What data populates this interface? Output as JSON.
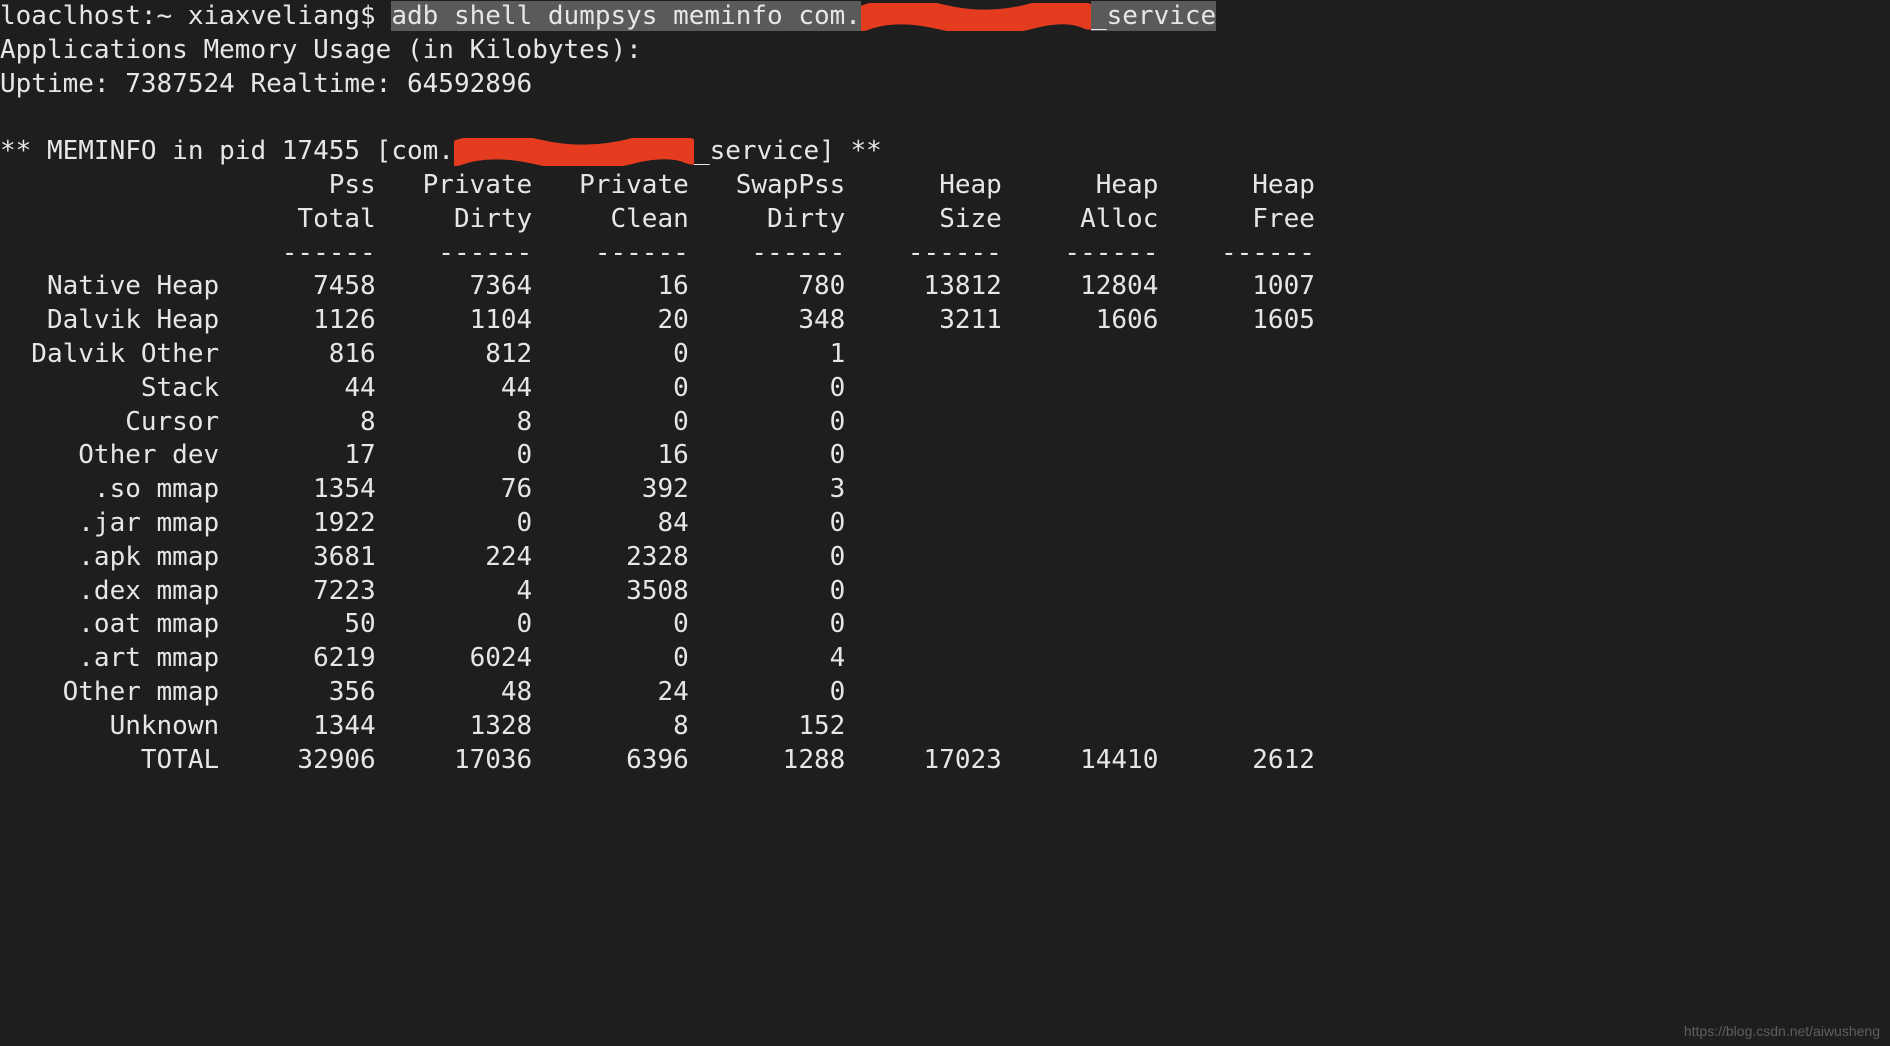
{
  "prompt": {
    "host_user": "loaclhost:~ xiaxveliang$ ",
    "cmd_prefix": "adb shell dumpsys meminfo com.",
    "cmd_suffix": "_service"
  },
  "header": {
    "line1": "Applications Memory Usage (in Kilobytes):",
    "line2_pref": "Uptime: ",
    "uptime": "7387524",
    "realtime_pref": " Realtime: ",
    "realtime": "64592896"
  },
  "meminfo_hdr": {
    "prefix": "** MEMINFO in pid ",
    "pid": "17455",
    "mid": " [com.",
    "suffix": "_service] **"
  },
  "cols": {
    "h1": [
      "",
      "Pss",
      "Private",
      "Private",
      "SwapPss",
      "Heap",
      "Heap",
      "Heap"
    ],
    "h2": [
      "",
      "Total",
      "Dirty",
      "Clean",
      "Dirty",
      "Size",
      "Alloc",
      "Free"
    ]
  },
  "rows": [
    {
      "name": "Native Heap",
      "v": [
        "7458",
        "7364",
        "16",
        "780",
        "13812",
        "12804",
        "1007"
      ]
    },
    {
      "name": "Dalvik Heap",
      "v": [
        "1126",
        "1104",
        "20",
        "348",
        "3211",
        "1606",
        "1605"
      ]
    },
    {
      "name": "Dalvik Other",
      "v": [
        "816",
        "812",
        "0",
        "1",
        "",
        "",
        ""
      ]
    },
    {
      "name": "Stack",
      "v": [
        "44",
        "44",
        "0",
        "0",
        "",
        "",
        ""
      ]
    },
    {
      "name": "Cursor",
      "v": [
        "8",
        "8",
        "0",
        "0",
        "",
        "",
        ""
      ]
    },
    {
      "name": "Other dev",
      "v": [
        "17",
        "0",
        "16",
        "0",
        "",
        "",
        ""
      ]
    },
    {
      "name": ".so mmap",
      "v": [
        "1354",
        "76",
        "392",
        "3",
        "",
        "",
        ""
      ]
    },
    {
      "name": ".jar mmap",
      "v": [
        "1922",
        "0",
        "84",
        "0",
        "",
        "",
        ""
      ]
    },
    {
      "name": ".apk mmap",
      "v": [
        "3681",
        "224",
        "2328",
        "0",
        "",
        "",
        ""
      ]
    },
    {
      "name": ".dex mmap",
      "v": [
        "7223",
        "4",
        "3508",
        "0",
        "",
        "",
        ""
      ]
    },
    {
      "name": ".oat mmap",
      "v": [
        "50",
        "0",
        "0",
        "0",
        "",
        "",
        ""
      ]
    },
    {
      "name": ".art mmap",
      "v": [
        "6219",
        "6024",
        "0",
        "4",
        "",
        "",
        ""
      ]
    },
    {
      "name": "Other mmap",
      "v": [
        "356",
        "48",
        "24",
        "0",
        "",
        "",
        ""
      ]
    },
    {
      "name": "Unknown",
      "v": [
        "1344",
        "1328",
        "8",
        "152",
        "",
        "",
        ""
      ]
    },
    {
      "name": "TOTAL",
      "v": [
        "32906",
        "17036",
        "6396",
        "1288",
        "17023",
        "14410",
        "2612"
      ]
    }
  ],
  "watermark": "https://blog.csdn.net/aiwusheng"
}
